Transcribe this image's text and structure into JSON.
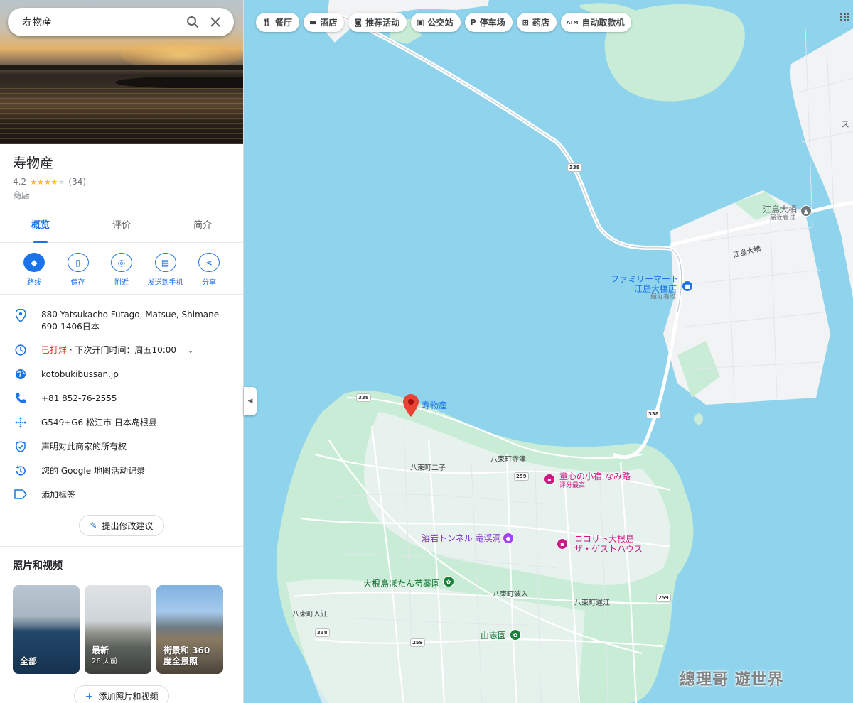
{
  "search": {
    "query": "寿物産"
  },
  "place": {
    "title": "寿物産",
    "rating": "4.2",
    "review_count": "(34)",
    "category": "商店"
  },
  "tabs": [
    "概览",
    "评价",
    "简介"
  ],
  "actions": [
    {
      "label": "路线",
      "icon": "directions-icon"
    },
    {
      "label": "保存",
      "icon": "bookmark-icon"
    },
    {
      "label": "附近",
      "icon": "nearby-icon"
    },
    {
      "label": "发送到手机",
      "icon": "send-to-phone-icon"
    },
    {
      "label": "分享",
      "icon": "share-icon"
    }
  ],
  "info": {
    "address": "880 Yatsukacho Futago, Matsue, Shimane 690-1406日本",
    "hours_status": "已打烊",
    "hours_next": " · 下次开门时间：周五10:00",
    "website": "kotobukibussan.jp",
    "phone": "+81 852-76-2555",
    "plus_code": "G549+G6 松江市 日本岛根县",
    "claim": "声明对此商家的所有权",
    "activity": "您的 Google 地图活动记录",
    "label": "添加标签"
  },
  "suggest_edit": "提出修改建议",
  "photos": {
    "heading": "照片和视频",
    "items": [
      {
        "label": "全部",
        "sub": ""
      },
      {
        "label": "最新",
        "sub": "26 天前"
      },
      {
        "label": "街景和 360 度全景照",
        "sub": ""
      }
    ],
    "add_button": "添加照片和视频"
  },
  "map": {
    "chips": [
      {
        "label": "餐厅",
        "icon": "restaurant-icon"
      },
      {
        "label": "酒店",
        "icon": "hotel-icon"
      },
      {
        "label": "推荐活动",
        "icon": "camera-icon"
      },
      {
        "label": "公交站",
        "icon": "bus-icon"
      },
      {
        "label": "停车场",
        "icon": "parking-icon"
      },
      {
        "label": "药店",
        "icon": "pharmacy-icon"
      },
      {
        "label": "自动取款机",
        "icon": "atm-icon"
      }
    ],
    "labels": {
      "pin": "寿物産",
      "eshima_bridge": "江島大橋",
      "recent_visit": "最近看过",
      "eshima_bridge_road": "江島大橋",
      "familymart_1": "ファミリーマート",
      "familymart_2": "江島大橋店",
      "familymart_sub": "最近看过",
      "futago": "八束町二子",
      "terazu": "八束町寺津",
      "inn_1": "童心の小宿 なみ路",
      "inn_sub": "评分最高",
      "tunnel": "溶岩トンネル 竜渓洞",
      "kokoriti_1": "ココリト大根島",
      "kokoriti_2": "ザ・ゲストハウス",
      "botan": "大根島ぼたん芍薬園",
      "hanyu": "八束町波入",
      "irie": "八束町入江",
      "ebie": "八束町遅江",
      "yushien": "由志園",
      "route_338": "338",
      "route_259": "259",
      "edge_text": "ス"
    },
    "watermark": "總理哥 遊世界"
  }
}
